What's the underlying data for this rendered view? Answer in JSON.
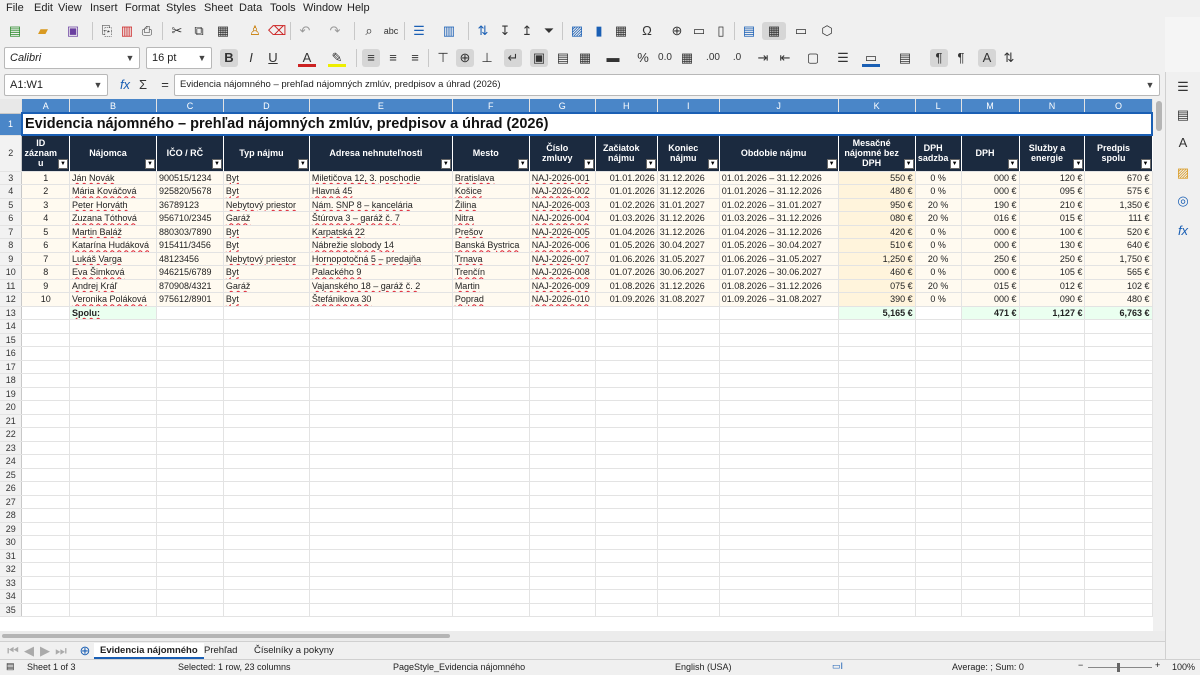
{
  "menu": [
    "File",
    "Edit",
    "View",
    "Insert",
    "Format",
    "Styles",
    "Sheet",
    "Data",
    "Tools",
    "Window",
    "Help"
  ],
  "font_name": "Calibri",
  "font_size": "16 pt",
  "name_box": "A1:W1",
  "formula": "Evidencia nájomného – prehľad nájomných zmlúv, predpisov a úhrad (2026)",
  "columns": [
    "A",
    "B",
    "C",
    "D",
    "E",
    "F",
    "G",
    "H",
    "I",
    "J",
    "K",
    "L",
    "M",
    "N",
    "O"
  ],
  "title": "Evidencia nájomného – prehľad nájomných zmlúv, predpisov a úhrad (2026)",
  "headers": [
    "ID záznam u",
    "Nájomca",
    "IČO / RČ",
    "Typ nájmu",
    "Adresa nehnuteľnosti",
    "Mesto",
    "Číslo zmluvy",
    "Začiatok nájmu",
    "Koniec nájmu",
    "Obdobie nájmu",
    "Mesačné nájomné bez DPH",
    "DPH sadzba",
    "DPH",
    "Služby a energie",
    "Predpis spolu"
  ],
  "rows": [
    [
      "1",
      "Ján Novák",
      "900515/1234",
      "Byt",
      "Miletičova 12, 3. poschodie",
      "Bratislava",
      "NAJ-2026-001",
      "01.01.2026",
      "31.12.2026",
      "01.01.2026 – 31.12.2026",
      "550 €",
      "0 %",
      "000 €",
      "120 €",
      "670 €"
    ],
    [
      "2",
      "Mária Kováčová",
      "925820/5678",
      "Byt",
      "Hlavná 45",
      "Košice",
      "NAJ-2026-002",
      "01.01.2026",
      "31.12.2026",
      "01.01.2026 – 31.12.2026",
      "480 €",
      "0 %",
      "000 €",
      "095 €",
      "575 €"
    ],
    [
      "3",
      "Peter Horváth",
      "36789123",
      "Nebytový priestor",
      "Nám. SNP 8 – kancelária",
      "Žilina",
      "NAJ-2026-003",
      "01.02.2026",
      "31.01.2027",
      "01.02.2026 – 31.01.2027",
      "950 €",
      "20 %",
      "190 €",
      "210 €",
      "1,350 €"
    ],
    [
      "4",
      "Zuzana Tóthová",
      "956710/2345",
      "Garáž",
      "Štúrova 3 – garáž č. 7",
      "Nitra",
      "NAJ-2026-004",
      "01.03.2026",
      "31.12.2026",
      "01.03.2026 – 31.12.2026",
      "080 €",
      "20 %",
      "016 €",
      "015 €",
      "111 €"
    ],
    [
      "5",
      "Martin Baláž",
      "880303/7890",
      "Byt",
      "Karpatská 22",
      "Prešov",
      "NAJ-2026-005",
      "01.04.2026",
      "31.12.2026",
      "01.04.2026 – 31.12.2026",
      "420 €",
      "0 %",
      "000 €",
      "100 €",
      "520 €"
    ],
    [
      "6",
      "Katarína Hudáková",
      "915411/3456",
      "Byt",
      "Nábrežie slobody 14",
      "Banská Bystrica",
      "NAJ-2026-006",
      "01.05.2026",
      "30.04.2027",
      "01.05.2026 – 30.04.2027",
      "510 €",
      "0 %",
      "000 €",
      "130 €",
      "640 €"
    ],
    [
      "7",
      "Lukáš Varga",
      "48123456",
      "Nebytový priestor",
      "Hornopotočná 5 – predajňa",
      "Trnava",
      "NAJ-2026-007",
      "01.06.2026",
      "31.05.2027",
      "01.06.2026 – 31.05.2027",
      "1,250 €",
      "20 %",
      "250 €",
      "250 €",
      "1,750 €"
    ],
    [
      "8",
      "Eva Šimková",
      "946215/6789",
      "Byt",
      "Palackého 9",
      "Trenčín",
      "NAJ-2026-008",
      "01.07.2026",
      "30.06.2027",
      "01.07.2026 – 30.06.2027",
      "460 €",
      "0 %",
      "000 €",
      "105 €",
      "565 €"
    ],
    [
      "9",
      "Andrej Kráľ",
      "870908/4321",
      "Garáž",
      "Vajanského 18 – garáž č. 2",
      "Martin",
      "NAJ-2026-009",
      "01.08.2026",
      "31.12.2026",
      "01.08.2026 – 31.12.2026",
      "075 €",
      "20 %",
      "015 €",
      "012 €",
      "102 €"
    ],
    [
      "10",
      "Veronika Poláková",
      "975612/8901",
      "Byt",
      "Štefánikova 30",
      "Poprad",
      "NAJ-2026-010",
      "01.09.2026",
      "31.08.2027",
      "01.09.2026 – 31.08.2027",
      "390 €",
      "0 %",
      "000 €",
      "090 €",
      "480 €"
    ]
  ],
  "sum_label": "Spolu:",
  "sums": {
    "K": "5,165 €",
    "M": "471 €",
    "N": "1,127 €",
    "O": "6,763 €"
  },
  "row_numbers": [
    1,
    2,
    3,
    4,
    5,
    6,
    7,
    8,
    9,
    10,
    11,
    12,
    13,
    14,
    15,
    16,
    17,
    18,
    19,
    20,
    21,
    22,
    23,
    24,
    25,
    26,
    27,
    28,
    29,
    30,
    31,
    32,
    33,
    34,
    35
  ],
  "tabs": [
    "Evidencia nájomného",
    "Prehľad",
    "Číselníky a pokyny"
  ],
  "status": {
    "sheet": "Sheet 1 of 3",
    "selection": "Selected: 1 row, 23 columns",
    "page_style": "PageStyle_Evidencia nájomného",
    "language": "English (USA)",
    "summary": "Average: ; Sum: 0",
    "zoom": "100%"
  }
}
